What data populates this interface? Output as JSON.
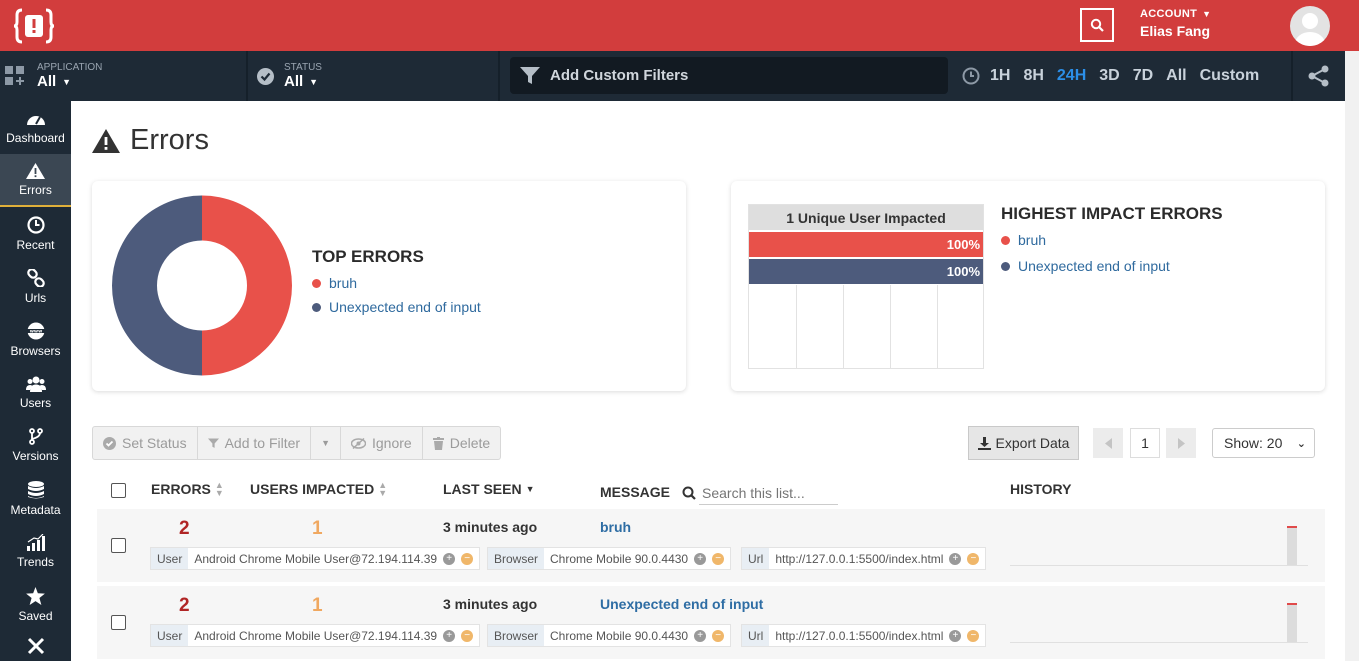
{
  "header": {
    "account_label": "ACCOUNT",
    "account_name": "Elias Fang"
  },
  "filters": {
    "application_label": "APPLICATION",
    "application_value": "All",
    "status_label": "STATUS",
    "status_value": "All",
    "custom_filter_label": "Add Custom Filters",
    "time_ranges": [
      "1H",
      "8H",
      "24H",
      "3D",
      "7D",
      "All",
      "Custom"
    ],
    "active_range": "24H"
  },
  "sidebar": {
    "items": [
      {
        "label": "Dashboard",
        "icon": "dashboard-icon"
      },
      {
        "label": "Errors",
        "icon": "warning-icon"
      },
      {
        "label": "Recent",
        "icon": "clock-icon"
      },
      {
        "label": "Urls",
        "icon": "link-icon"
      },
      {
        "label": "Browsers",
        "icon": "www-icon"
      },
      {
        "label": "Users",
        "icon": "users-icon"
      },
      {
        "label": "Versions",
        "icon": "branch-icon"
      },
      {
        "label": "Metadata",
        "icon": "database-icon"
      },
      {
        "label": "Trends",
        "icon": "trends-icon"
      },
      {
        "label": "Saved",
        "icon": "star-icon"
      }
    ]
  },
  "page": {
    "title": "Errors"
  },
  "top_errors": {
    "title": "TOP ERRORS",
    "items": [
      {
        "label": "bruh",
        "color": "#e8514a",
        "value": 2
      },
      {
        "label": "Unexpected end of input",
        "color": "#4d5b7c",
        "value": 2
      }
    ]
  },
  "impact": {
    "title": "HIGHEST IMPACT ERRORS",
    "header": "1 Unique User Impacted",
    "items": [
      {
        "label": "bruh",
        "color": "#e8514a",
        "pct": "100%"
      },
      {
        "label": "Unexpected end of input",
        "color": "#4d5b7c",
        "pct": "100%"
      }
    ]
  },
  "toolbar": {
    "set_status": "Set Status",
    "add_to_filter": "Add to Filter",
    "ignore": "Ignore",
    "delete": "Delete",
    "export": "Export Data",
    "page": "1",
    "show": "Show: 20"
  },
  "table": {
    "headers": {
      "errors": "ERRORS",
      "users": "USERS IMPACTED",
      "last_seen": "LAST SEEN",
      "message": "MESSAGE",
      "history": "HISTORY"
    },
    "search_placeholder": "Search this list...",
    "rows": [
      {
        "errors": "2",
        "users": "1",
        "last_seen": "3 minutes ago",
        "message": "bruh",
        "tags": [
          {
            "k": "User",
            "v": "Android Chrome Mobile User@72.194.114.39"
          },
          {
            "k": "Browser",
            "v": "Chrome Mobile 90.0.4430"
          },
          {
            "k": "Url",
            "v": "http://127.0.0.1:5500/index.html"
          }
        ]
      },
      {
        "errors": "2",
        "users": "1",
        "last_seen": "3 minutes ago",
        "message": "Unexpected end of input",
        "tags": [
          {
            "k": "User",
            "v": "Android Chrome Mobile User@72.194.114.39"
          },
          {
            "k": "Browser",
            "v": "Chrome Mobile 90.0.4430"
          },
          {
            "k": "Url",
            "v": "http://127.0.0.1:5500/index.html"
          }
        ]
      }
    ]
  }
}
